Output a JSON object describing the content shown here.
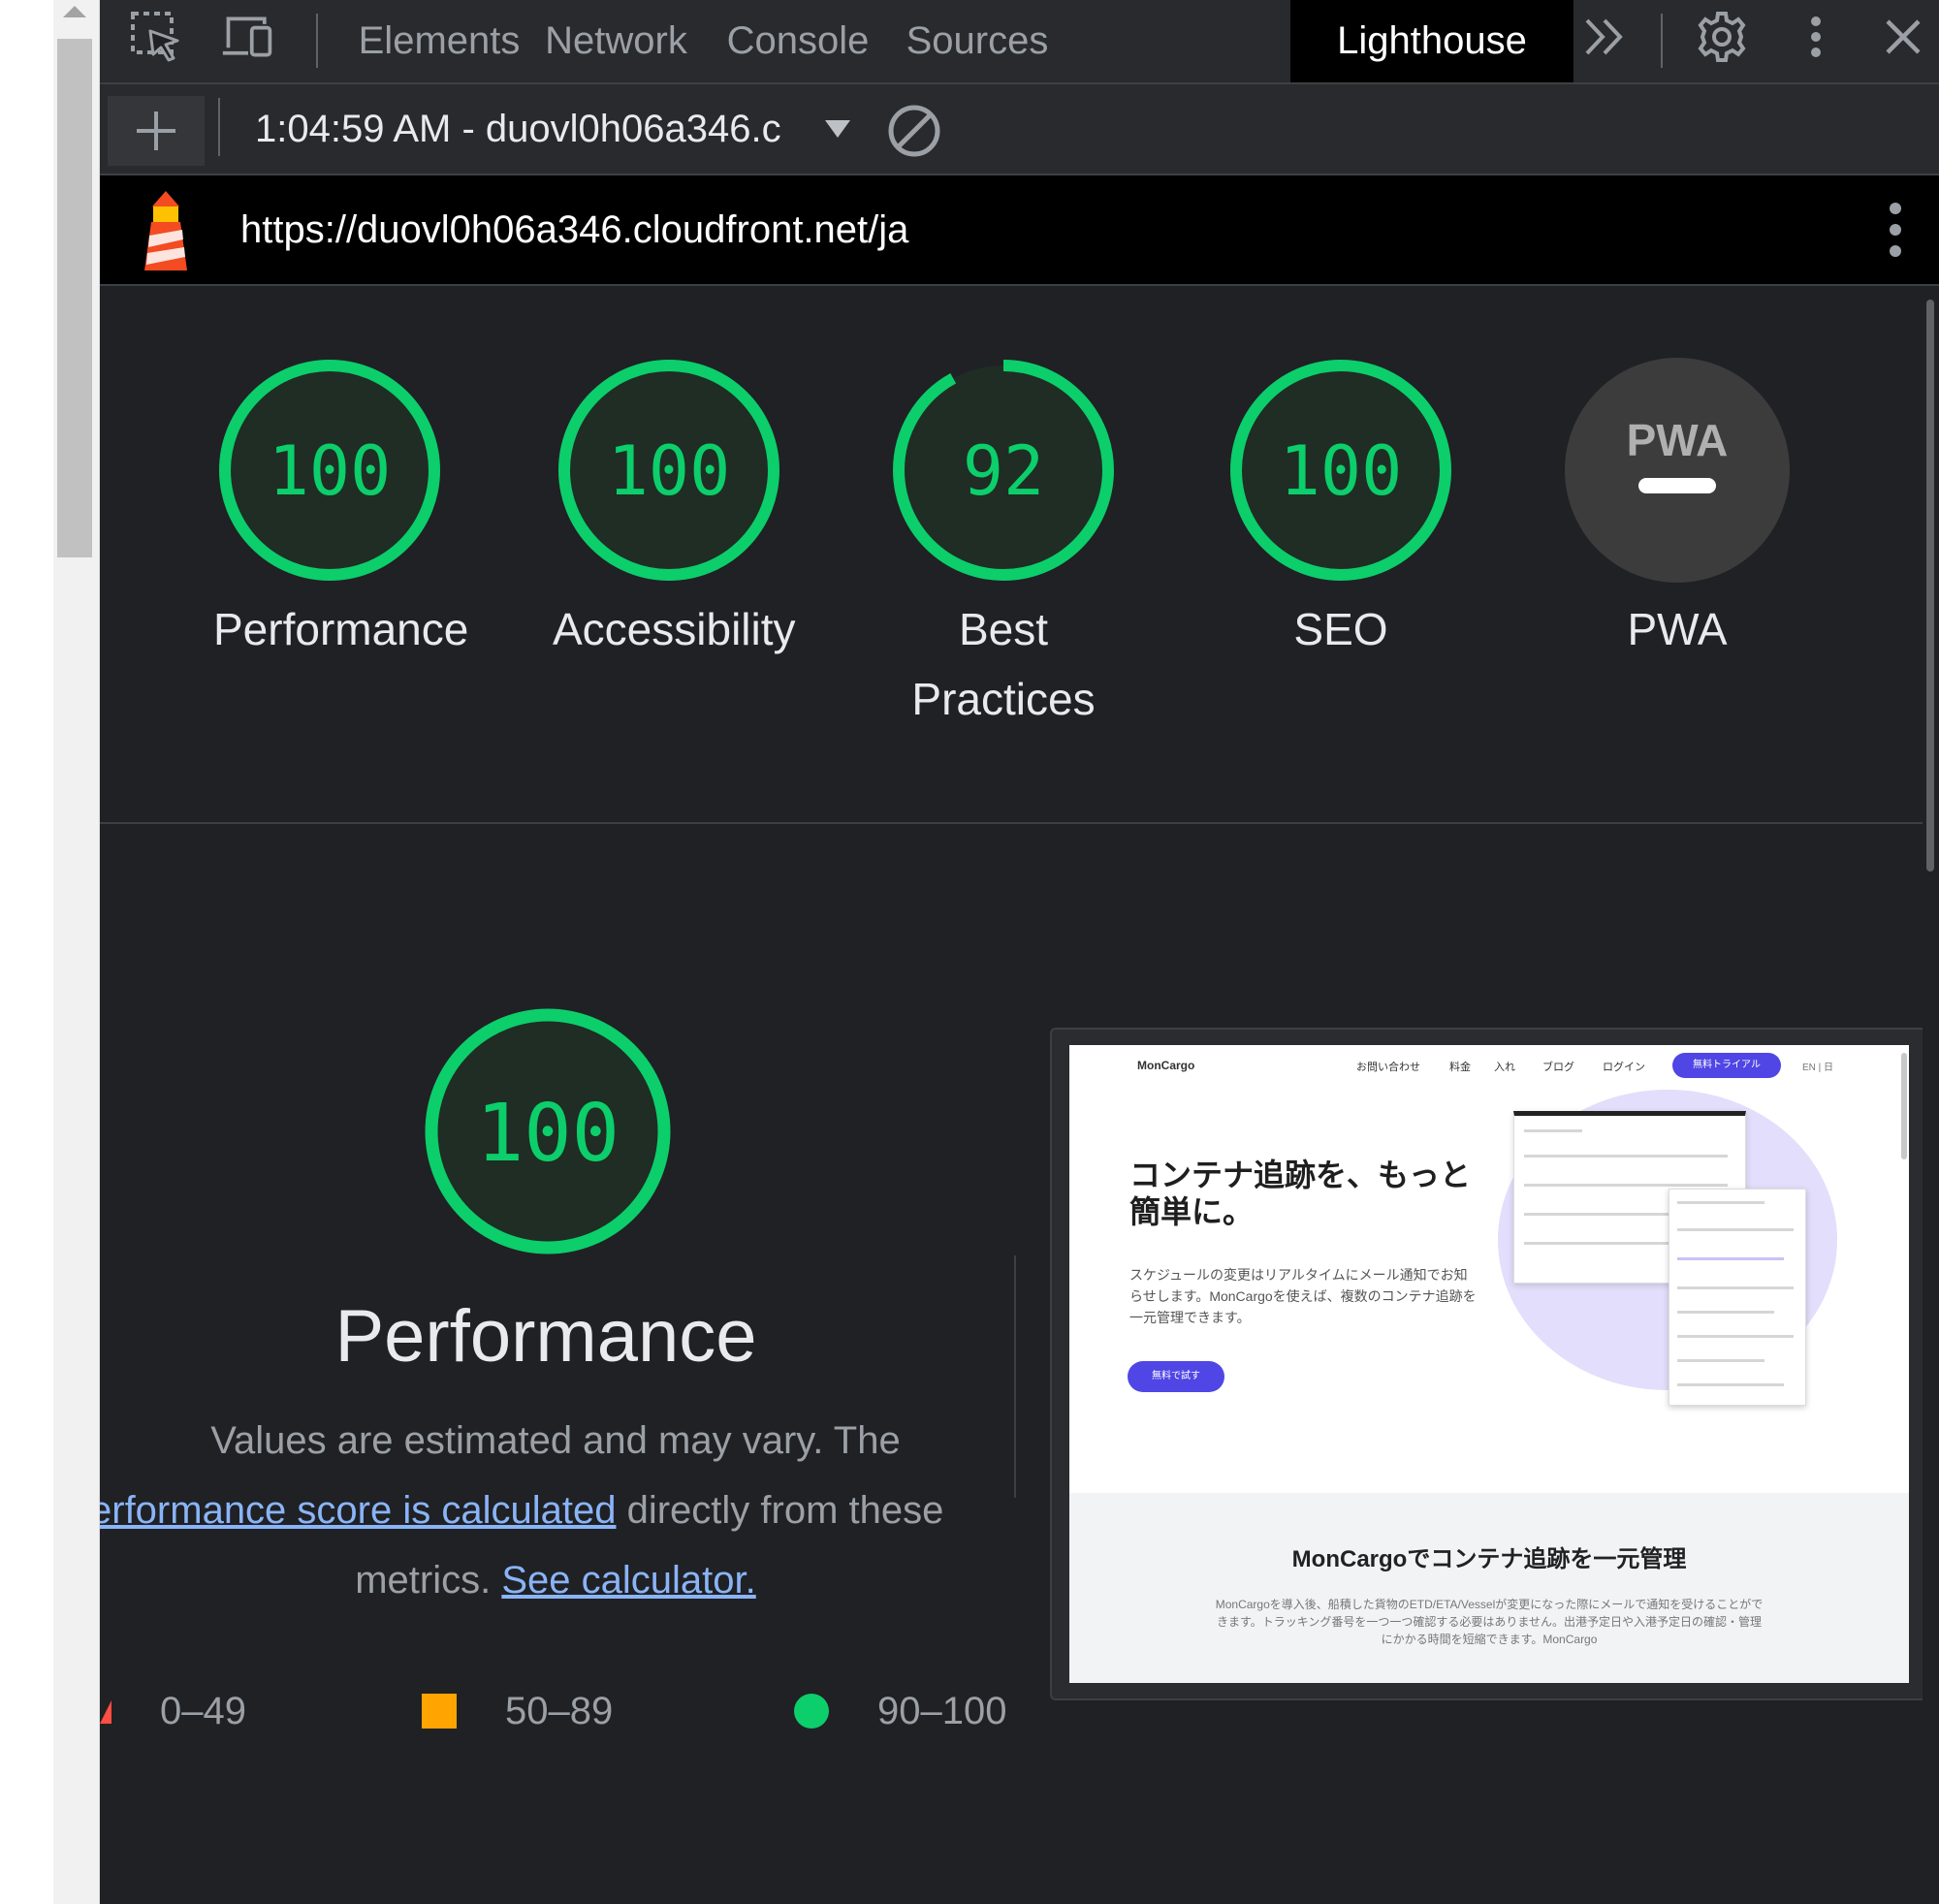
{
  "devtools": {
    "tabs": [
      "Elements",
      "Network",
      "Console",
      "Sources",
      "Lighthouse"
    ],
    "active_tab": "Lighthouse",
    "report_select_label": "1:04:59 AM - duovl0h06a346.c",
    "report_url": "https://duovl0h06a346.cloudfront.net/ja"
  },
  "scores": [
    {
      "label": "Performance",
      "value": "100",
      "score": 100
    },
    {
      "label": "Accessibility",
      "value": "100",
      "score": 100
    },
    {
      "label": "Best Practices",
      "value": "92",
      "score": 92
    },
    {
      "label": "SEO",
      "value": "100",
      "score": 100
    },
    {
      "label": "PWA",
      "value": "",
      "badge": "PWA"
    }
  ],
  "performance": {
    "score": "100",
    "score_value": 100,
    "title": "Performance",
    "desc_line1": "Values are estimated and may vary. The",
    "desc_link1": "erformance score is calculated",
    "desc_line2_rest": " directly from these",
    "desc_line3_text": "metrics. ",
    "desc_link2": "See calculator."
  },
  "legend": [
    {
      "range": "0–49",
      "shape": "triangle",
      "color": "#ff4e42"
    },
    {
      "range": "50–89",
      "shape": "square",
      "color": "#ffa400"
    },
    {
      "range": "90–100",
      "shape": "circle",
      "color": "#0cce6b"
    }
  ],
  "screenshot": {
    "logo": "MonCargo",
    "nav": [
      "お問い合わせ",
      "料金",
      "入れ",
      "ブログ",
      "ログイン"
    ],
    "cta": "無料トライアル",
    "lang": "EN | 日",
    "headline": "コンテナ追跡を、もっと簡単に。",
    "subtext": "スケジュールの変更はリアルタイムにメール通知でお知らせします。MonCargoを使えば、複数のコンテナ追跡を一元管理できます。",
    "hero_button": "無料で試す",
    "section_title": "MonCargoでコンテナ追跡を一元管理",
    "section_text": "MonCargoを導入後、船積した貨物のETD/ETA/Vesselが変更になった際にメールで通知を受けることができます。トラッキング番号を一つ一つ確認する必要はありません。出港予定日や入港予定日の確認・管理にかかる時間を短縮できます。MonCargo"
  },
  "colors": {
    "pass_green": "#0cce6b",
    "link_blue": "#8ab4f8",
    "pwa_gray": "#3c3c3c"
  },
  "icons": [
    "inspect-element-icon",
    "device-toolbar-icon",
    "more-tabs-icon",
    "settings-gear-icon",
    "kebab-menu-icon",
    "close-icon",
    "plus-icon",
    "clear-icon",
    "lighthouse-logo-icon"
  ]
}
